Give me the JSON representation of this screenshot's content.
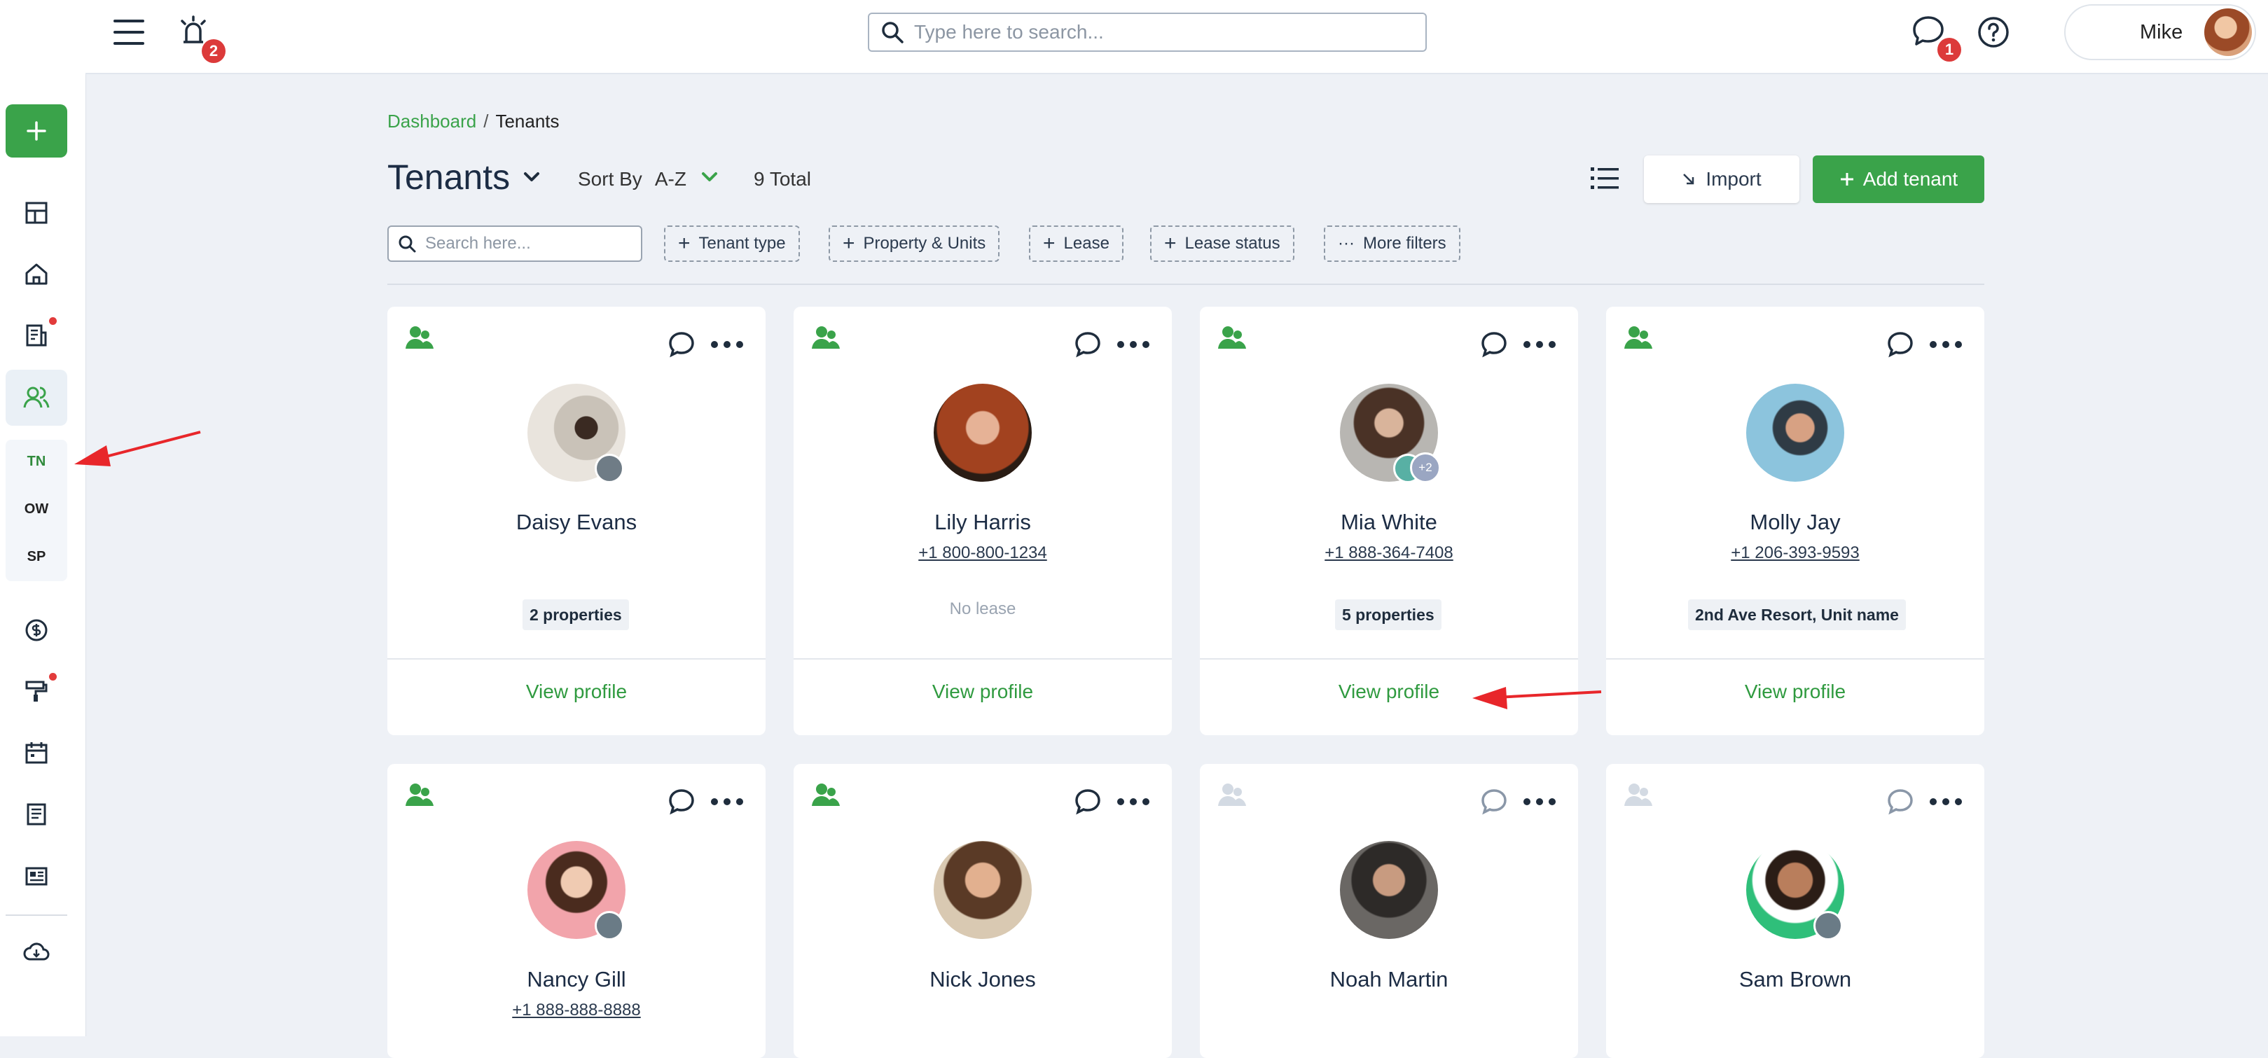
{
  "header": {
    "search_placeholder": "Type here to search...",
    "notifications_count": "2",
    "messages_count": "1",
    "user_name": "Mike"
  },
  "sidebar": {
    "subnav": [
      "TN",
      "OW",
      "SP"
    ]
  },
  "breadcrumb": {
    "items": [
      "Dashboard",
      "Tenants"
    ],
    "separator": "/"
  },
  "page": {
    "title": "Tenants",
    "sort_label": "Sort By",
    "sort_value": "A-Z",
    "total": "9 Total",
    "import_label": "Import",
    "add_label": "Add tenant"
  },
  "filters": {
    "search_placeholder": "Search here...",
    "chips": [
      "Tenant type",
      "Property & Units",
      "Lease",
      "Lease status",
      "More filters"
    ]
  },
  "tenants": [
    {
      "name": "Daisy Evans",
      "phone": "",
      "info": "2 properties",
      "info_type": "pill",
      "active": true,
      "action": "View profile"
    },
    {
      "name": "Lily Harris",
      "phone": "+1 800-800-1234",
      "info": "No lease",
      "info_type": "muted",
      "active": true,
      "action": "View profile"
    },
    {
      "name": "Mia White",
      "phone": "+1 888-364-7408",
      "info": "5 properties",
      "info_type": "pill",
      "active": true,
      "action": "View profile",
      "extra_count": "+2"
    },
    {
      "name": "Molly Jay",
      "phone": "+1 206-393-9593",
      "info": "2nd Ave Resort, Unit name",
      "info_type": "pill",
      "active": true,
      "action": "View profile"
    },
    {
      "name": "Nancy Gill",
      "phone": "+1 888-888-8888",
      "active": true
    },
    {
      "name": "Nick Jones",
      "phone": "",
      "active": true
    },
    {
      "name": "Noah Martin",
      "phone": "",
      "active": false
    },
    {
      "name": "Sam Brown",
      "phone": "",
      "active": false
    }
  ],
  "colors": {
    "brand_green": "#3aa34a",
    "badge_red": "#dc3a3a",
    "annotation_red": "#e8262a"
  }
}
